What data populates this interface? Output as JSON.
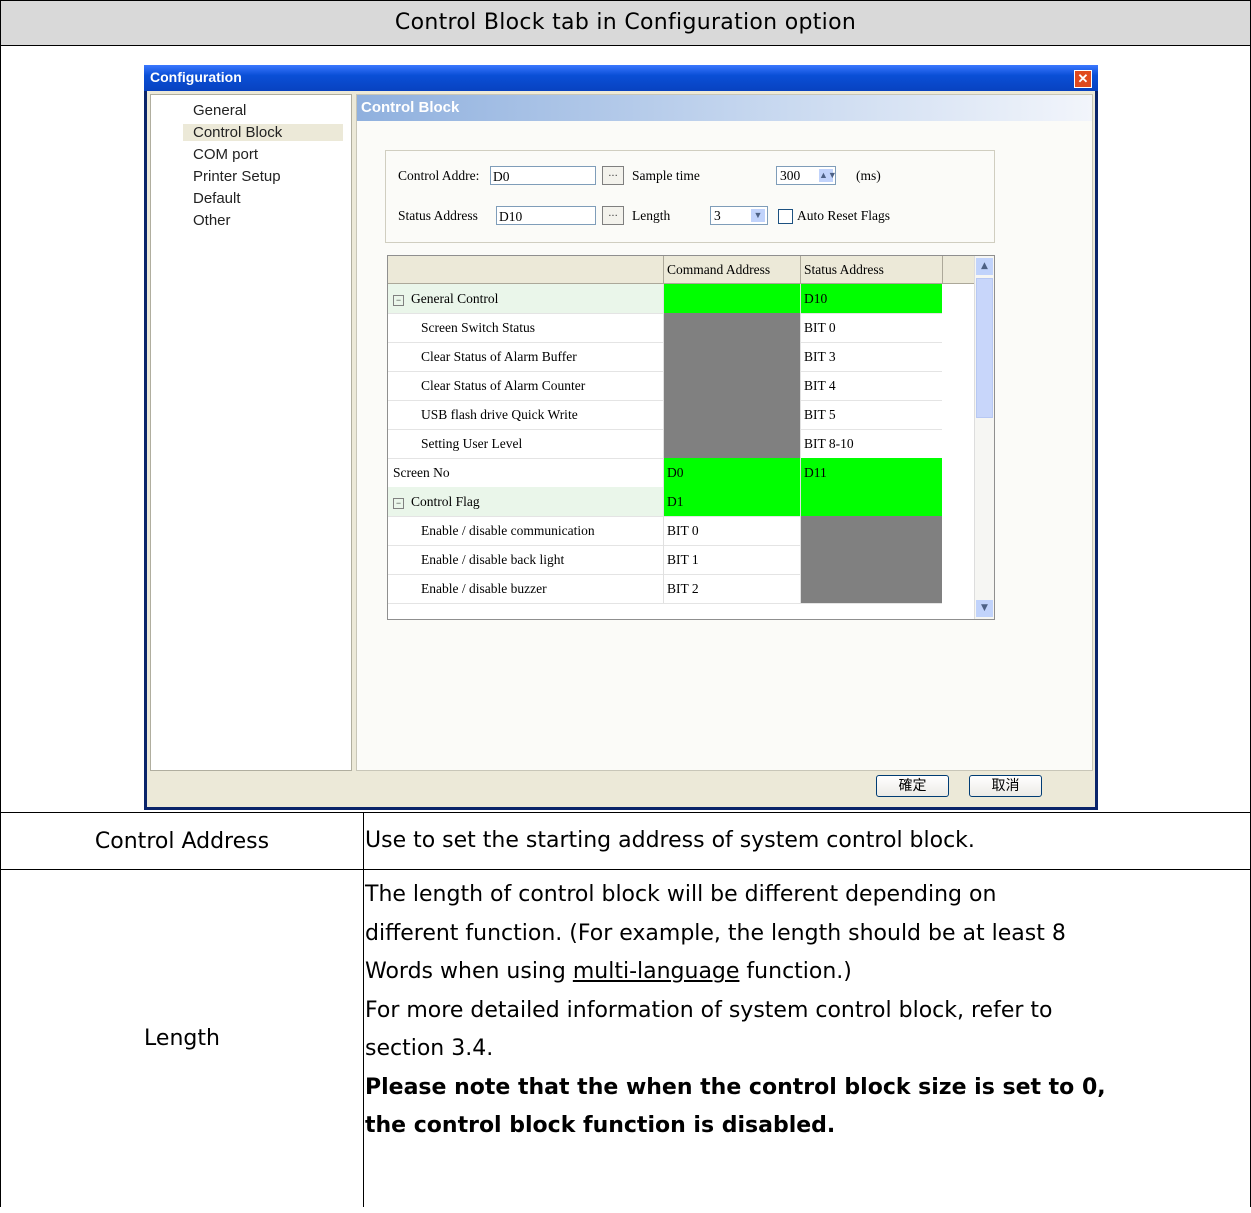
{
  "header": {
    "title": "Control Block tab in Configuration option"
  },
  "dialog": {
    "title": "Configuration",
    "sidebar": [
      "General",
      "Control Block",
      "COM port",
      "Printer Setup",
      "Default",
      "Other"
    ],
    "panel_title": "Control Block",
    "control_addr_label": "Control Addre:",
    "control_addr_value": "D0",
    "sample_time_label": "Sample time",
    "sample_time_value": "300",
    "sample_time_unit": "(ms)",
    "status_addr_label": "Status Address",
    "status_addr_value": "D10",
    "length_label": "Length",
    "length_value": "3",
    "auto_reset_label": "Auto Reset Flags",
    "browse_label": "...",
    "grid": {
      "headers": [
        "",
        "Command Address",
        "Status Address"
      ],
      "rows": [
        {
          "name": "General Control",
          "cmd": "",
          "status": "D10"
        },
        {
          "name": "Screen Switch Status",
          "cmd": "",
          "status": "BIT 0"
        },
        {
          "name": "Clear Status of Alarm Buffer",
          "cmd": "",
          "status": "BIT 3"
        },
        {
          "name": "Clear Status of Alarm Counter",
          "cmd": "",
          "status": "BIT 4"
        },
        {
          "name": "USB flash drive Quick Write",
          "cmd": "",
          "status": "BIT 5"
        },
        {
          "name": "Setting User Level",
          "cmd": "",
          "status": "BIT 8-10"
        },
        {
          "name": "Screen No",
          "cmd": "D0",
          "status": "D11"
        },
        {
          "name": "Control Flag",
          "cmd": "D1",
          "status": ""
        },
        {
          "name": "Enable / disable communication",
          "cmd": "BIT 0",
          "status": ""
        },
        {
          "name": "Enable / disable back light",
          "cmd": "BIT 1",
          "status": ""
        },
        {
          "name": "Enable / disable buzzer",
          "cmd": "BIT 2",
          "status": ""
        }
      ]
    },
    "ok_label": "確定",
    "cancel_label": "取消"
  },
  "table": {
    "row1": {
      "term": "Control Address",
      "desc": "Use to set the starting address of system control block."
    },
    "row2": {
      "term": "Length",
      "line1": "The length of control block will be different depending on",
      "line2": "different function. (For example, the length should be at least 8",
      "line3a": "Words when using ",
      "line3link": "multi-language",
      "line3b": " function.)",
      "line4": "For more detailed information of system control block, refer to",
      "line5": "section 3.4.",
      "line6": "Please note that the when the control block size is set to 0,",
      "line7": "the control block function is disabled."
    }
  }
}
